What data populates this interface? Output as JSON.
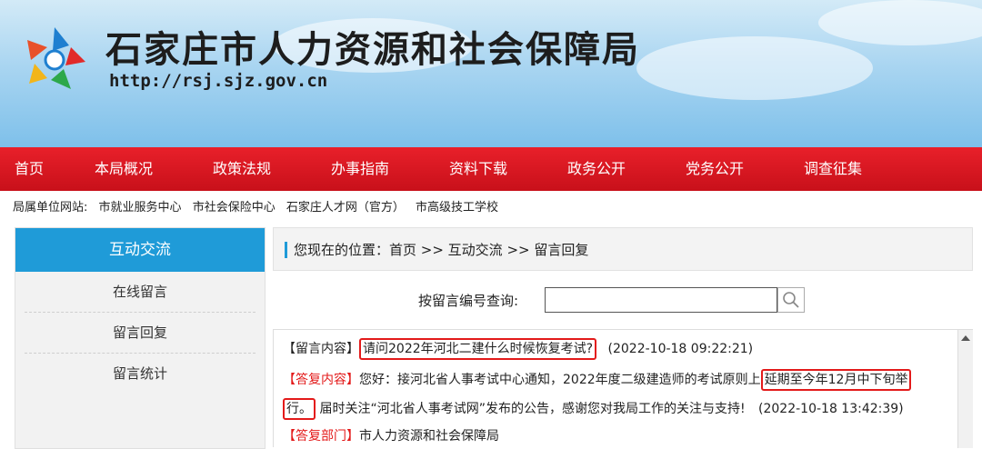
{
  "header": {
    "title": "石家庄市人力资源和社会保障局",
    "url": "http://rsj.sjz.gov.cn"
  },
  "nav": [
    "首页",
    "本局概况",
    "政策法规",
    "办事指南",
    "资料下载",
    "政务公开",
    "党务公开",
    "调查征集"
  ],
  "sub_units": {
    "label": "局属单位网站:",
    "links": [
      "市就业服务中心",
      "市社会保险中心",
      "石家庄人才网（官方）",
      "市高级技工学校"
    ]
  },
  "sidebar": {
    "title": "互动交流",
    "items": [
      "在线留言",
      "留言回复",
      "留言统计"
    ]
  },
  "breadcrumb": "您现在的位置：首页 >> 互动交流 >> 留言回复",
  "search": {
    "label": "按留言编号查询:",
    "value": ""
  },
  "message": {
    "content_tag": "【留言内容】",
    "content_text": "请问2022年河北二建什么时候恢复考试?",
    "content_time": "(2022-10-18 09:22:21)",
    "reply_tag": "【答复内容】",
    "reply_text_1": "您好：接河北省人事考试中心通知，2022年度二级建造师的考试原则上",
    "reply_highlight_1": "延期至今年12月中下旬举",
    "reply_highlight_2": "行。",
    "reply_text_2": "届时关注“河北省人事考试网”发布的公告，感谢您对我局工作的关注与支持!",
    "reply_time": "(2022-10-18 13:42:39)",
    "dept_tag": "【答复部门】",
    "dept_text": "市人力资源和社会保障局"
  },
  "colors": {
    "nav_red": "#d9141e",
    "accent_blue": "#1f9bd8",
    "highlight_red": "#e31a1a"
  }
}
